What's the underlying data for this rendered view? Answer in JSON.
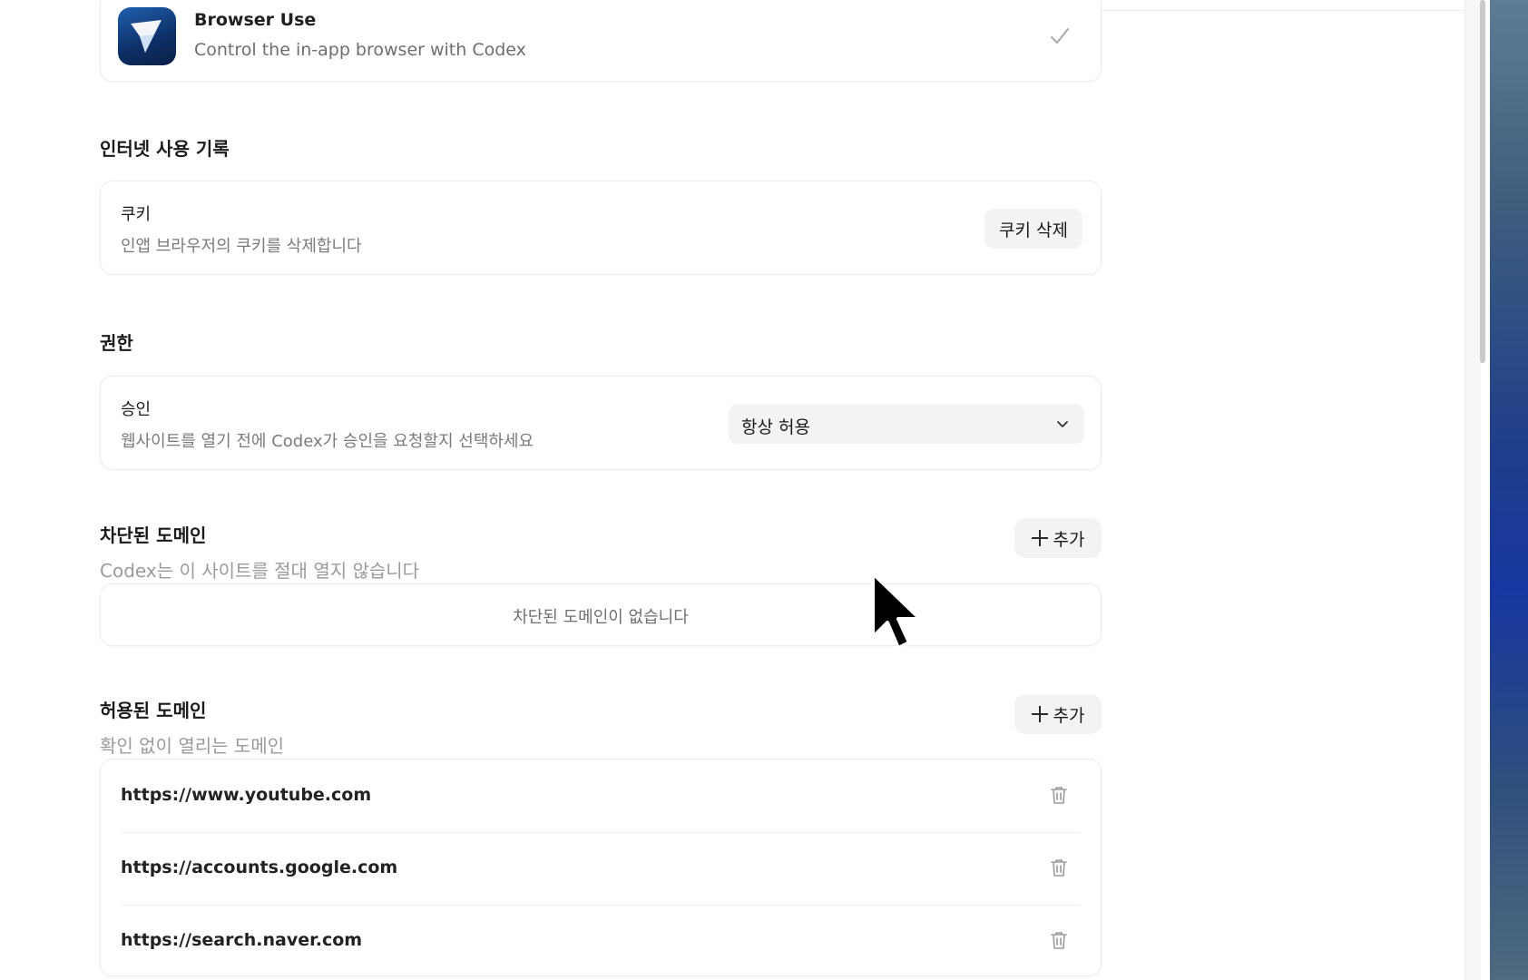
{
  "plugin": {
    "name": "Browser Use",
    "description": "Control the in-app browser with Codex",
    "icon": "browser-use-logo-icon",
    "enabled_icon": "checkmark-icon"
  },
  "history": {
    "title": "인터넷 사용 기록",
    "cookies": {
      "title": "쿠키",
      "description": "인앱 브라우저의 쿠키를 삭제합니다",
      "button": "쿠키 삭제"
    }
  },
  "permissions": {
    "title": "권한",
    "approval": {
      "title": "승인",
      "description": "웹사이트를 열기 전에 Codex가 승인을 요청할지 선택하세요",
      "selected": "항상 허용"
    }
  },
  "blocked": {
    "title": "차단된 도메인",
    "subtitle": "Codex는 이 사이트를 절대 열지 않습니다",
    "add_label": "추가",
    "empty": "차단된 도메인이 없습니다"
  },
  "allowed": {
    "title": "허용된 도메인",
    "subtitle": "확인 없이 열리는 도메인",
    "add_label": "추가",
    "domains": [
      "https://www.youtube.com",
      "https://accounts.google.com",
      "https://search.naver.com"
    ]
  },
  "colors": {
    "accent": "#1f5fae",
    "button_bg": "#f3f3f3",
    "muted_text": "#7a7a7a"
  }
}
